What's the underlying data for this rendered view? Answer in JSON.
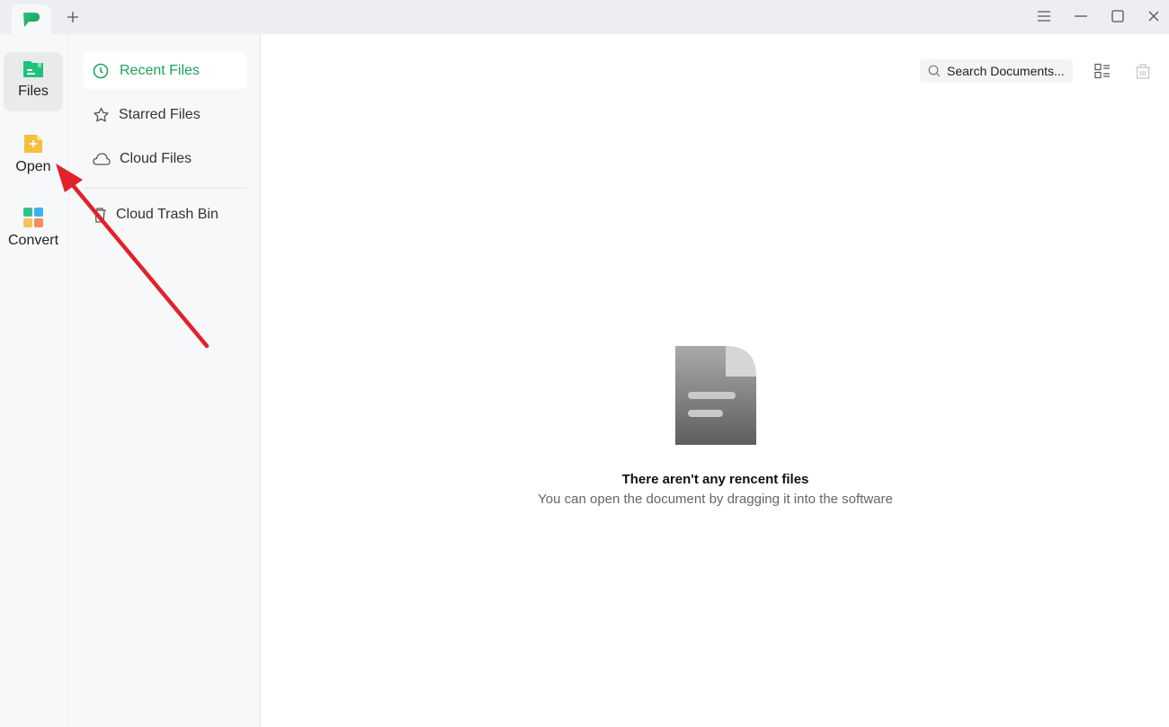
{
  "titlebar": {
    "tab_icon": "app-logo-icon",
    "new_tab_icon": "plus-icon",
    "controls": [
      {
        "name": "menu",
        "icon": "hamburger-icon"
      },
      {
        "name": "minimize",
        "icon": "minimize-icon"
      },
      {
        "name": "maximize",
        "icon": "maximize-icon"
      },
      {
        "name": "close",
        "icon": "close-icon"
      }
    ]
  },
  "rail": {
    "items": [
      {
        "label": "Files",
        "icon": "files-folder-icon",
        "color": "#1fc27a",
        "active": true
      },
      {
        "label": "Open",
        "icon": "open-file-plus-icon",
        "color": "#f5bf3a",
        "active": false
      },
      {
        "label": "Convert",
        "icon": "convert-grid-icon",
        "color": "#2fc28a",
        "active": false
      }
    ]
  },
  "nav": {
    "items": [
      {
        "label": "Recent Files",
        "icon": "clock-icon",
        "active": true
      },
      {
        "label": "Starred Files",
        "icon": "star-icon",
        "active": false
      },
      {
        "label": "Cloud Files",
        "icon": "cloud-icon",
        "active": false
      },
      {
        "label": "Cloud Trash Bin",
        "icon": "trash-icon",
        "active": false
      }
    ],
    "accent": "#1aa35c"
  },
  "toolbar": {
    "search_placeholder": "Search Documents...",
    "view_toggle_icon": "list-view-icon",
    "delete_icon": "trash-icon"
  },
  "empty_state": {
    "icon": "document-icon",
    "title": "There aren't any rencent files",
    "subtitle": "You can open the document by dragging it into the software"
  },
  "annotation": {
    "type": "arrow",
    "color": "#e0222b",
    "points_to": "Open"
  }
}
